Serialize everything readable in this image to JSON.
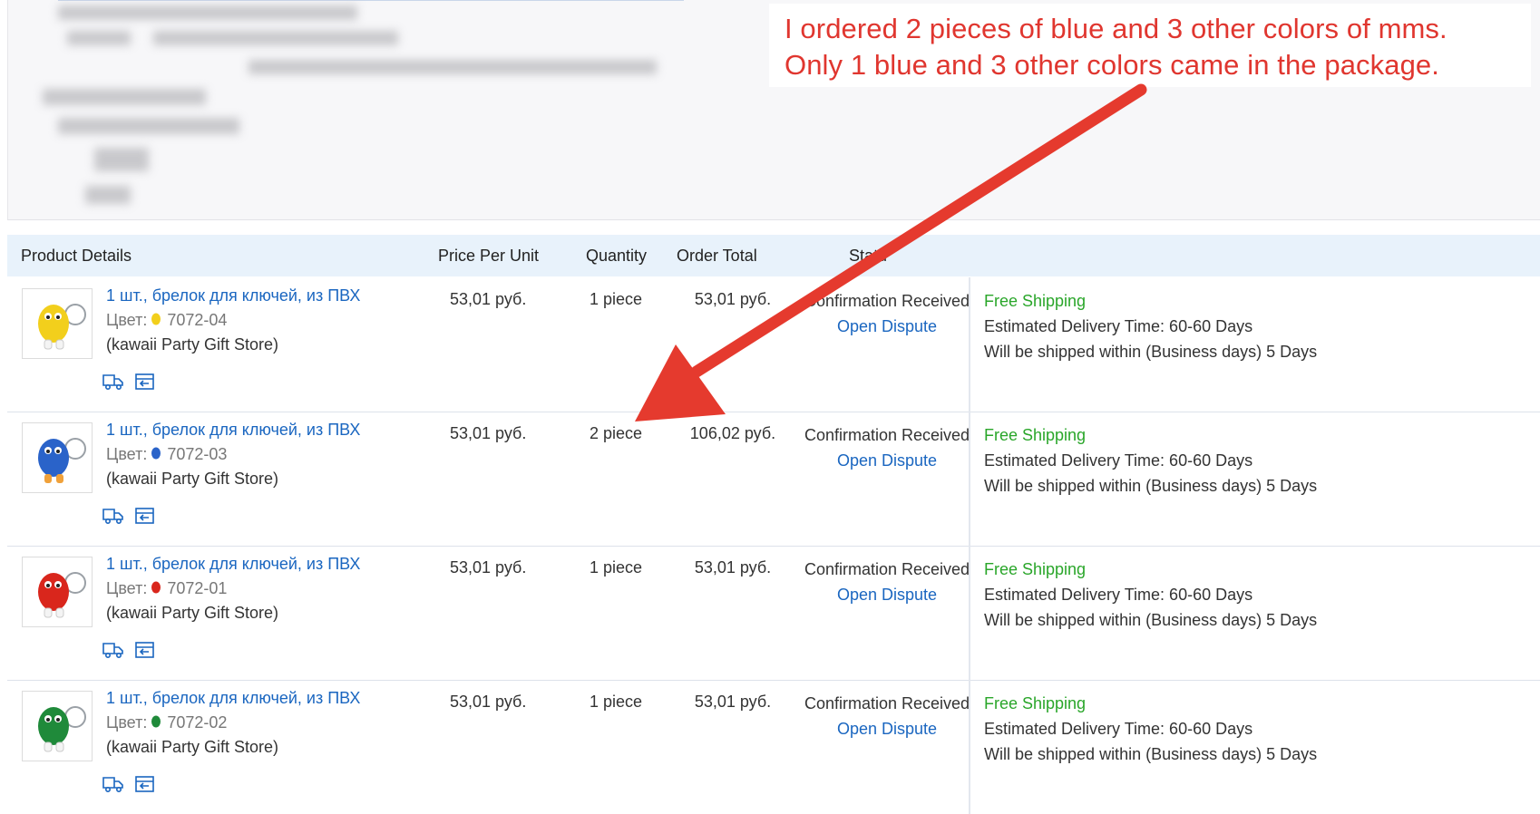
{
  "annotation": {
    "line1": "I ordered 2 pieces of blue and 3 other colors of mms.",
    "line2": "Only 1 blue and 3 other colors came in the package.",
    "color": "#e0362f"
  },
  "table": {
    "headers": {
      "product": "Product Details",
      "price": "Price Per Unit",
      "quantity": "Quantity",
      "total": "Order Total",
      "status": "Statu"
    }
  },
  "items": [
    {
      "title": "1 шт., брелок для ключей, из ПВХ",
      "color_label": "Цвет:",
      "color_code": "7072-04",
      "figure_color": "#f2cf1c",
      "store": "(kawaii Party Gift Store)",
      "price": "53,01 руб.",
      "quantity": "1 piece",
      "total": "53,01 руб.",
      "status_text": "Confirmation Received",
      "dispute_link_1": "Open",
      "dispute_link_2": "Dispute",
      "shipping": "Free Shipping",
      "delivery": "Estimated Delivery Time: 60-60 Days",
      "ship_within": "Will be shipped within (Business days) 5 Days"
    },
    {
      "title": "1 шт., брелок для ключей, из ПВХ",
      "color_label": "Цвет:",
      "color_code": "7072-03",
      "figure_color": "#2a63c9",
      "store": "(kawaii Party Gift Store)",
      "price": "53,01 руб.",
      "quantity": "2 piece",
      "total": "106,02 руб.",
      "status_text": "Confirmation Received",
      "dispute_link_1": "Open",
      "dispute_link_2": "Dispute",
      "shipping": "Free Shipping",
      "delivery": "Estimated Delivery Time: 60-60 Days",
      "ship_within": "Will be shipped within (Business days) 5 Days"
    },
    {
      "title": "1 шт., брелок для ключей, из ПВХ",
      "color_label": "Цвет:",
      "color_code": "7072-01",
      "figure_color": "#d9261c",
      "store": "(kawaii Party Gift Store)",
      "price": "53,01 руб.",
      "quantity": "1 piece",
      "total": "53,01 руб.",
      "status_text": "Confirmation Received",
      "dispute_link_1": "Open",
      "dispute_link_2": "Dispute",
      "shipping": "Free Shipping",
      "delivery": "Estimated Delivery Time: 60-60 Days",
      "ship_within": "Will be shipped within (Business days) 5 Days"
    },
    {
      "title": "1 шт., брелок для ключей, из ПВХ",
      "color_label": "Цвет:",
      "color_code": "7072-02",
      "figure_color": "#1f8a3a",
      "store": "(kawaii Party Gift Store)",
      "price": "53,01 руб.",
      "quantity": "1 piece",
      "total": "53,01 руб.",
      "status_text": "Confirmation Received",
      "dispute_link_1": "Open",
      "dispute_link_2": "Dispute",
      "shipping": "Free Shipping",
      "delivery": "Estimated Delivery Time: 60-60 Days",
      "ship_within": "Will be shipped within (Business days) 5 Days"
    }
  ],
  "icons": {
    "track": "truck-icon",
    "return": "return-box-icon",
    "link_color": "#1a66c0",
    "shipping_color": "#2aa62a"
  }
}
